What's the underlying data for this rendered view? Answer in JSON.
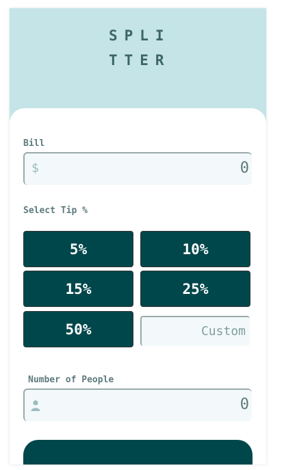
{
  "app": {
    "logo_line1": "SPLI",
    "logo_line2": "TTER"
  },
  "bill": {
    "label": "Bill",
    "currency": "$",
    "value": "0"
  },
  "tip": {
    "label": "Select Tip %",
    "options": [
      "5%",
      "10%",
      "15%",
      "25%",
      "50%"
    ],
    "custom_placeholder": "Custom"
  },
  "people": {
    "label": "Number of People",
    "value": "0",
    "icon": "person-icon"
  },
  "colors": {
    "accent": "#00474b",
    "background": "#c5e4e7",
    "input_bg": "#f3f9fa",
    "label": "#5e7a7d"
  }
}
